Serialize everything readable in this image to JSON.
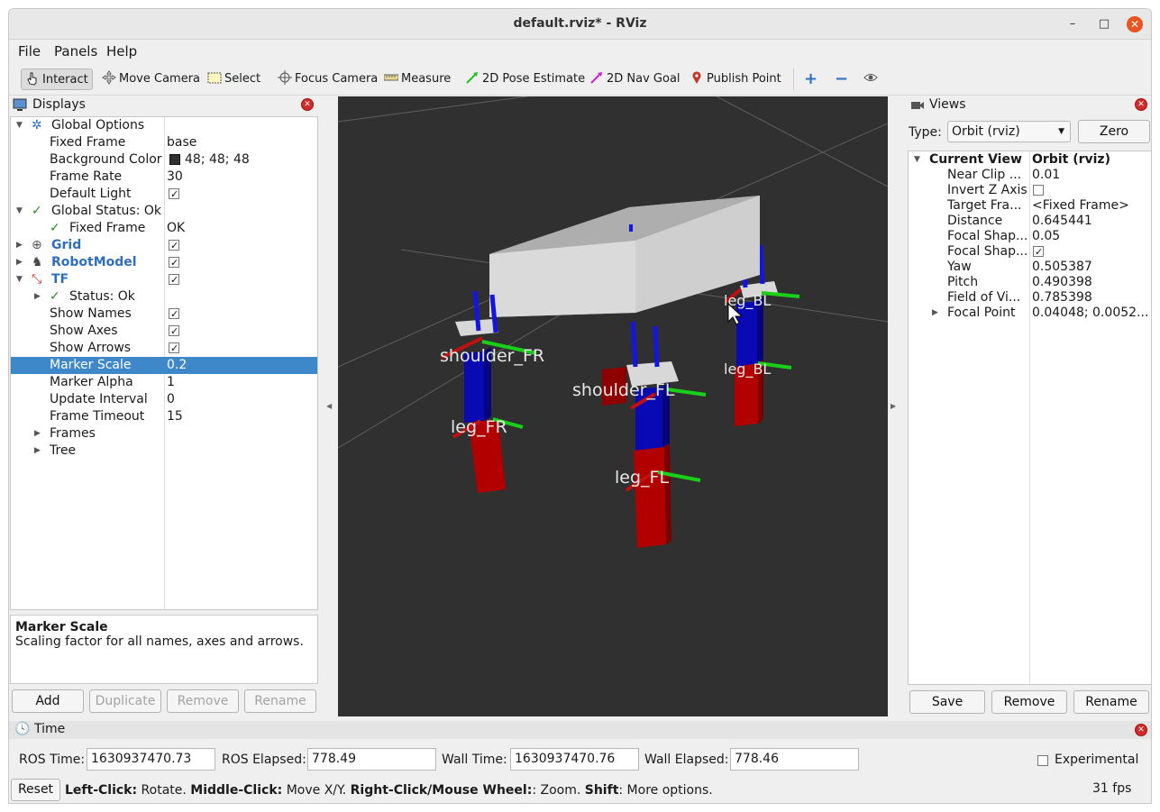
{
  "window": {
    "title": "default.rviz* - RViz",
    "controls": {
      "minimize": "–",
      "maximize": "□",
      "close": "✕"
    }
  },
  "menu": {
    "items": [
      "File",
      "Panels",
      "Help"
    ]
  },
  "toolbar": {
    "tools": [
      "Interact",
      "Move Camera",
      "Select",
      "Focus Camera",
      "Measure",
      "2D Pose Estimate",
      "2D Nav Goal",
      "Publish Point"
    ],
    "active_tool": "Interact",
    "extra_icons": [
      "plus-icon",
      "minus-icon",
      "eye-icon"
    ]
  },
  "displays": {
    "header": "Displays",
    "rows": {
      "global_options": "Global Options",
      "fixed_frame_k": "Fixed Frame",
      "fixed_frame_v": "base",
      "bg_color_k": "Background Color",
      "bg_color_v": "48; 48; 48",
      "frame_rate_k": "Frame Rate",
      "frame_rate_v": "30",
      "default_light_k": "Default Light",
      "default_light_v": true,
      "global_status": "Global Status: Ok",
      "gs_fixed_frame_k": "Fixed Frame",
      "gs_fixed_frame_v": "OK",
      "grid": "Grid",
      "grid_v": true,
      "robot_model": "RobotModel",
      "robot_model_v": true,
      "tf": "TF",
      "tf_v": true,
      "status_ok": "Status: Ok",
      "show_names_k": "Show Names",
      "show_names_v": true,
      "show_axes_k": "Show Axes",
      "show_axes_v": true,
      "show_arrows_k": "Show Arrows",
      "show_arrows_v": true,
      "marker_scale_k": "Marker Scale",
      "marker_scale_v": "0.2",
      "marker_alpha_k": "Marker Alpha",
      "marker_alpha_v": "1",
      "update_interval_k": "Update Interval",
      "update_interval_v": "0",
      "frame_timeout_k": "Frame Timeout",
      "frame_timeout_v": "15",
      "frames": "Frames",
      "tree": "Tree"
    },
    "description_title": "Marker Scale",
    "description_text": "Scaling factor for all names, axes and arrows.",
    "buttons": {
      "add": "Add",
      "duplicate": "Duplicate",
      "remove": "Remove",
      "rename": "Rename"
    },
    "bg_swatch_color": "#303030"
  },
  "viewport": {
    "labels": [
      "shoulder_FR",
      "leg_FR",
      "leg_FL",
      "shoulder_FL",
      "leg_BL",
      "leg_BL"
    ],
    "colors": {
      "background": "#303030",
      "body": "#c9c9c9",
      "upper_leg": "#0b0bbb",
      "lower_leg": "#b00000",
      "x_axis": "#cc1111",
      "y_axis": "#11cc11",
      "z_axis": "#1111cc"
    }
  },
  "views": {
    "header": "Views",
    "type_label": "Type:",
    "type_value": "Orbit (rviz)",
    "zero_label": "Zero",
    "current_view_k": "Current View",
    "current_view_v": "Orbit (rviz)",
    "props": [
      {
        "k": "Near Clip ...",
        "v": "0.01"
      },
      {
        "k": "Invert Z Axis",
        "v": ""
      },
      {
        "k": "Target Fra...",
        "v": "<Fixed Frame>"
      },
      {
        "k": "Distance",
        "v": "0.645441"
      },
      {
        "k": "Focal Shap...",
        "v": "0.05"
      },
      {
        "k": "Focal Shap...",
        "v": ""
      },
      {
        "k": "Yaw",
        "v": "0.505387"
      },
      {
        "k": "Pitch",
        "v": "0.490398"
      },
      {
        "k": "Field of Vi...",
        "v": "0.785398"
      },
      {
        "k": "Focal Point",
        "v": "0.04048; 0.0052..."
      }
    ],
    "invert_z_checked": false,
    "focal_shape_fixed_checked": true,
    "buttons": {
      "save": "Save",
      "remove": "Remove",
      "rename": "Rename"
    }
  },
  "time": {
    "header": "Time",
    "ros_time_label": "ROS Time:",
    "ros_time": "1630937470.73",
    "ros_elapsed_label": "ROS Elapsed:",
    "ros_elapsed": "778.49",
    "wall_time_label": "Wall Time:",
    "wall_time": "1630937470.76",
    "wall_elapsed_label": "Wall Elapsed:",
    "wall_elapsed": "778.46",
    "experimental": "Experimental"
  },
  "status": {
    "reset": "Reset",
    "lc_k": "Left-Click:",
    "lc_v": " Rotate. ",
    "mc_k": "Middle-Click:",
    "mc_v": " Move X/Y. ",
    "rc_k": "Right-Click/Mouse Wheel:",
    "rc_v": ": Zoom. ",
    "sh_k": "Shift",
    "sh_v": ": More options.",
    "fps": "31 fps"
  }
}
